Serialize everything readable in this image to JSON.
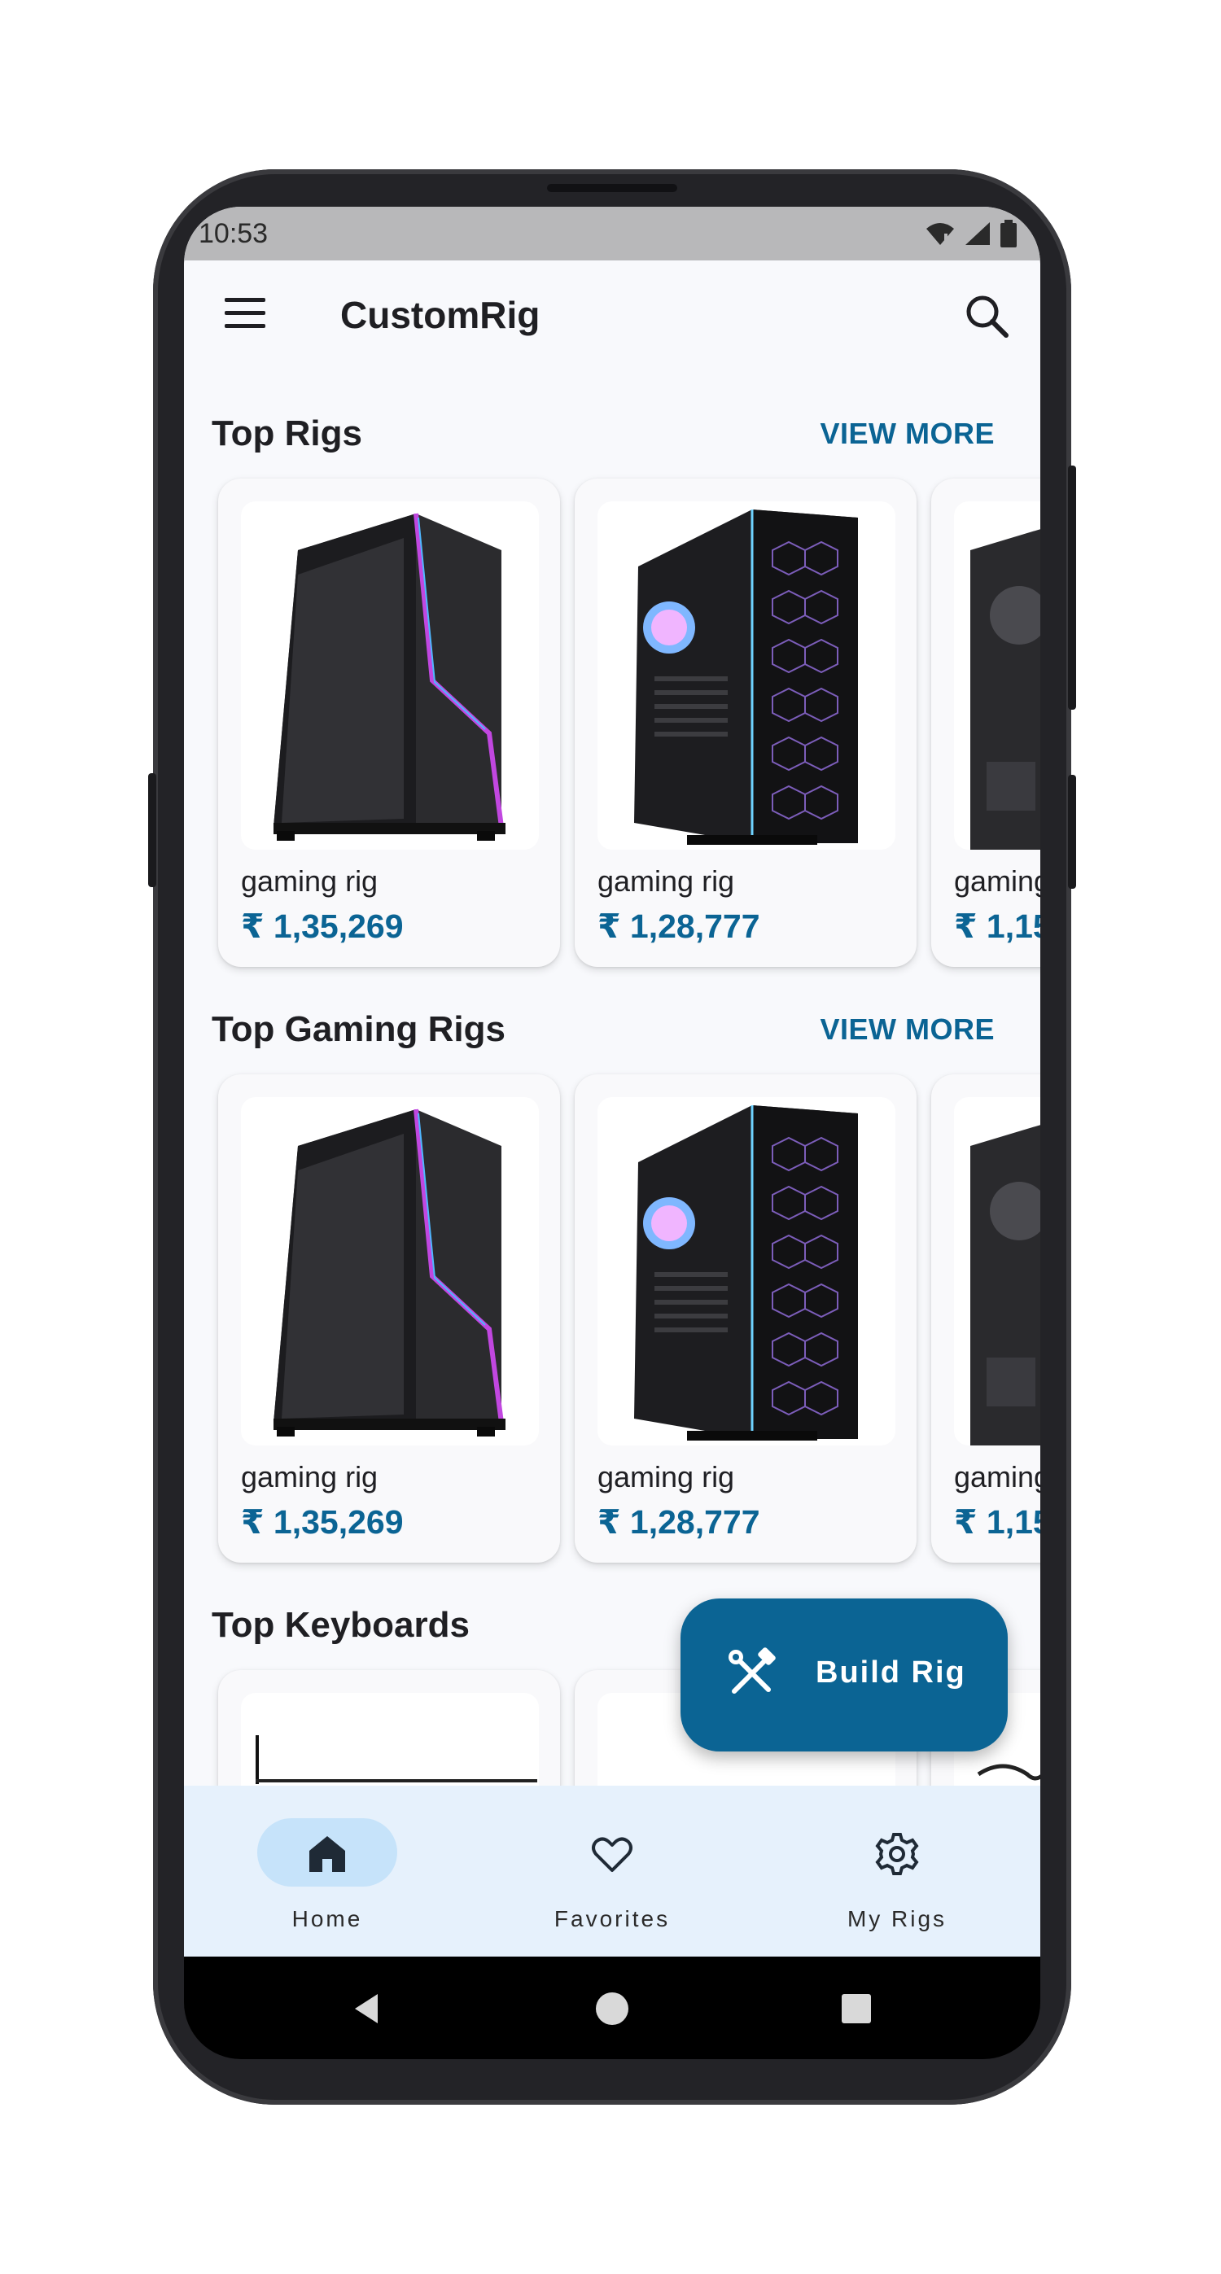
{
  "status_bar": {
    "time": "10:53"
  },
  "app_bar": {
    "title": "CustomRig"
  },
  "sections": [
    {
      "title": "Top Rigs",
      "view_more": "VIEW MORE",
      "cards": [
        {
          "name": "gaming rig",
          "price": "₹ 1,35,269"
        },
        {
          "name": "gaming rig",
          "price": "₹ 1,28,777"
        },
        {
          "name": "gaming rig",
          "price": "₹ 1,15"
        }
      ]
    },
    {
      "title": "Top Gaming Rigs",
      "view_more": "VIEW MORE",
      "cards": [
        {
          "name": "gaming rig",
          "price": "₹ 1,35,269"
        },
        {
          "name": "gaming rig",
          "price": "₹ 1,28,777"
        },
        {
          "name": "gaming rig",
          "price": "₹ 1,15"
        }
      ]
    },
    {
      "title": "Top Keyboards",
      "cards": []
    }
  ],
  "fab": {
    "label": "Build Rig",
    "icon": "tools-icon"
  },
  "bottom_nav": {
    "items": [
      {
        "label": "Home",
        "icon": "home-icon",
        "active": true
      },
      {
        "label": "Favorites",
        "icon": "heart-icon",
        "active": false
      },
      {
        "label": "My Rigs",
        "icon": "gear-icon",
        "active": false
      }
    ]
  },
  "colors": {
    "accent": "#0b6494",
    "nav_bg": "#e6f1fc",
    "nav_active": "#c6e3fa"
  }
}
